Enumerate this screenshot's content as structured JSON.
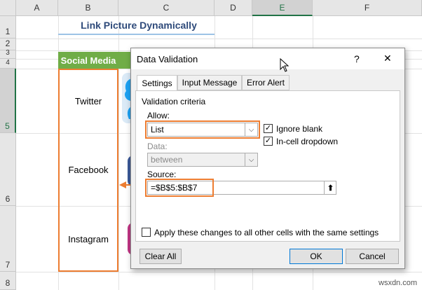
{
  "columns": [
    "A",
    "B",
    "C",
    "D",
    "E",
    "F"
  ],
  "rows": [
    "1",
    "2",
    "3",
    "4",
    "5",
    "6",
    "7",
    "8"
  ],
  "sheet": {
    "title": "Link Picture Dynamically",
    "header_cell": "Social Media",
    "items": [
      "Twitter",
      "Facebook",
      "Instagram"
    ]
  },
  "dialog": {
    "title": "Data Validation",
    "help": "?",
    "close": "✕",
    "tabs": [
      "Settings",
      "Input Message",
      "Error Alert"
    ],
    "section_label": "Validation criteria",
    "allow_label": "Allow:",
    "allow_value": "List",
    "ignore_blank_label": "Ignore blank",
    "ignore_blank_checked": true,
    "incell_dropdown_label": "In-cell dropdown",
    "incell_dropdown_checked": true,
    "data_label": "Data:",
    "data_value": "between",
    "source_label": "Source:",
    "source_value": "=$B$5:$B$7",
    "apply_label": "Apply these changes to all other cells with the same settings",
    "apply_checked": false,
    "clear_all": "Clear All",
    "ok": "OK",
    "cancel": "Cancel"
  },
  "watermark": "wsxdn.com",
  "colors": {
    "accent_orange": "#ed7d31",
    "header_green": "#70ad47",
    "title_blue": "#2e4a7a"
  }
}
